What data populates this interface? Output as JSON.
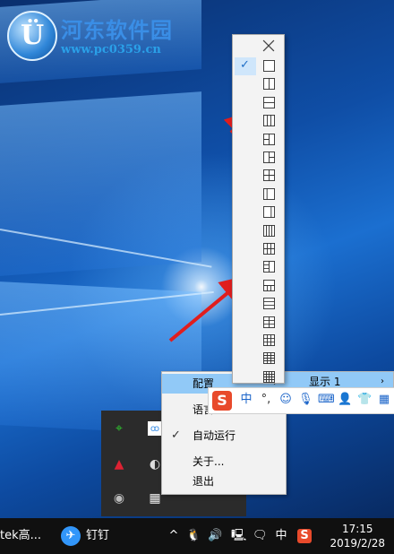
{
  "watermark": {
    "title": "河东软件园",
    "url": "www.pc0359.cn"
  },
  "context_menu": {
    "items": [
      {
        "label": "配置",
        "highlight": true,
        "has_submenu": true
      },
      {
        "label": "语言",
        "highlight": false,
        "has_submenu": true
      },
      {
        "label": "自动运行",
        "checked": true
      },
      {
        "label": "关于..."
      },
      {
        "label": "退出"
      }
    ]
  },
  "submenu": {
    "label": "显示 1"
  },
  "layout_panel": {
    "close_icon": "close-icon",
    "layouts": [
      "layout-single",
      "layout-split-vertical-2",
      "layout-split-horizontal-2",
      "layout-columns-3",
      "layout-left-2-right-1",
      "layout-left-1-right-2",
      "layout-grid-2x2",
      "layout-sidebar-left",
      "layout-sidebar-right",
      "layout-columns-4",
      "layout-grid-2x3",
      "layout-mixed-1",
      "layout-mixed-2",
      "layout-rows-3",
      "layout-grid-3x2",
      "layout-grid-3x3",
      "layout-grid-4x3",
      "layout-grid-4x4"
    ],
    "selected_index": 0
  },
  "ime_bar": {
    "logo": "S",
    "mode": "中"
  },
  "taskbar": {
    "left_app": "tek高...",
    "dingtalk": "钉钉",
    "tray_lang": "中",
    "time": "17:15",
    "date": "2019/2/28"
  },
  "colors": {
    "highlight": "#91c9f7",
    "taskbar": "#101010",
    "accent": "#3a8ee6"
  }
}
